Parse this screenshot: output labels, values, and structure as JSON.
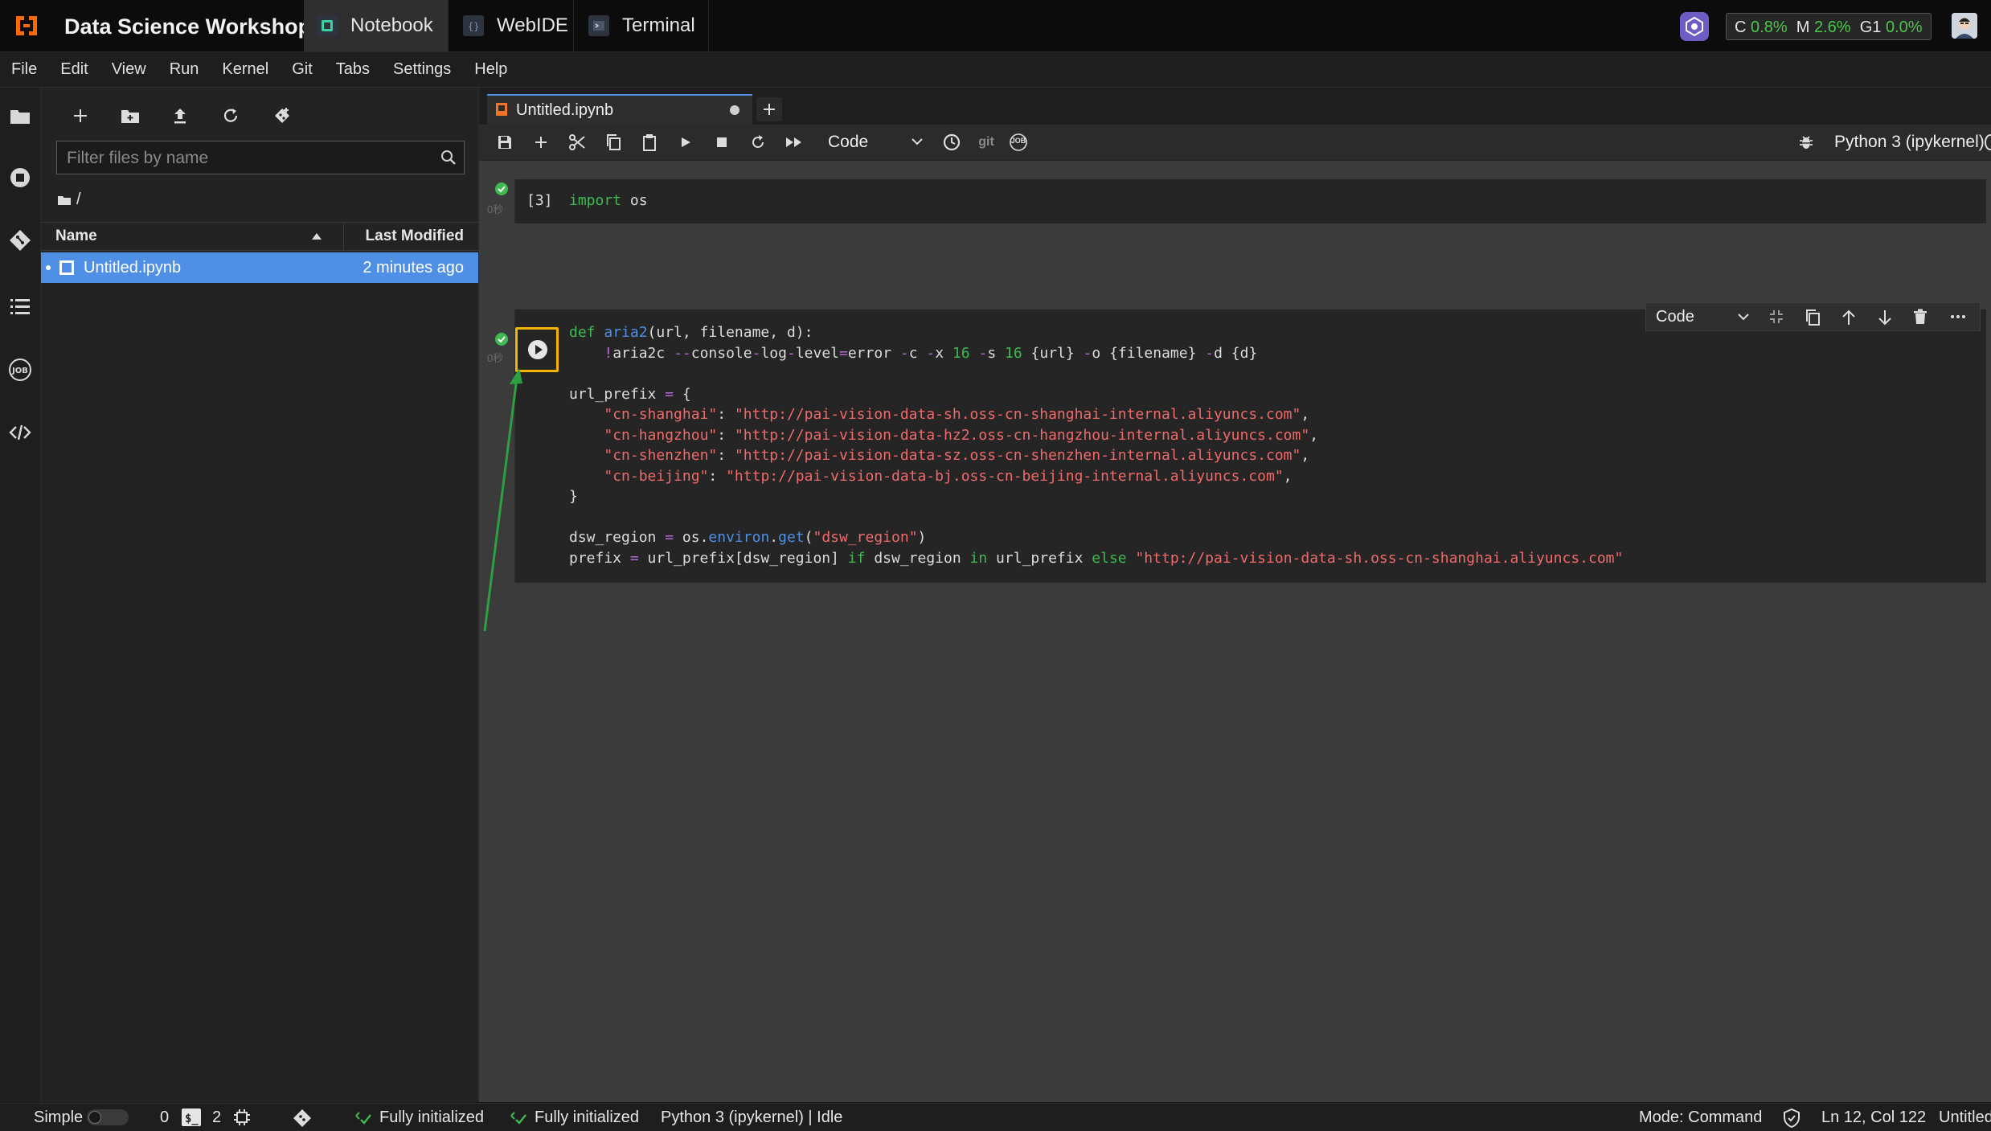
{
  "topbar": {
    "title": "Data Science Workshop",
    "tabs": [
      {
        "label": "Notebook",
        "icon": "notebook-icon"
      },
      {
        "label": "WebIDE",
        "icon": "webide-icon"
      },
      {
        "label": "Terminal",
        "icon": "terminal-icon"
      }
    ],
    "resources": {
      "c_label": "C",
      "c_value": "0.8%",
      "m_label": "M",
      "m_value": "2.6%",
      "g_label": "G1",
      "g_value": "0.0%"
    }
  },
  "menu": [
    "File",
    "Edit",
    "View",
    "Run",
    "Kernel",
    "Git",
    "Tabs",
    "Settings",
    "Help"
  ],
  "filebrowser": {
    "filter_placeholder": "Filter files by name",
    "breadcrumb": "/",
    "columns": {
      "name": "Name",
      "modified": "Last Modified"
    },
    "files": [
      {
        "name": "Untitled.ipynb",
        "modified": "2 minutes ago"
      }
    ]
  },
  "document": {
    "tab_label": "Untitled.ipynb",
    "cell_type": "Code",
    "git_label": "git",
    "job_label": "JOB",
    "kernel": "Python 3 (ipykernel)"
  },
  "cells": [
    {
      "prompt": "[3]",
      "lines": [
        [
          {
            "t": "import",
            "c": "kw"
          },
          {
            "t": " os",
            "c": ""
          }
        ]
      ]
    },
    {
      "prompt": "",
      "lines": [
        [
          {
            "t": "def",
            "c": "kw"
          },
          {
            "t": " ",
            "c": ""
          },
          {
            "t": "aria2",
            "c": "def"
          },
          {
            "t": "(url, filename, d):",
            "c": ""
          }
        ],
        [
          {
            "t": "    ",
            "c": ""
          },
          {
            "t": "!",
            "c": "op"
          },
          {
            "t": "aria2c ",
            "c": ""
          },
          {
            "t": "--",
            "c": "op"
          },
          {
            "t": "console",
            "c": ""
          },
          {
            "t": "-",
            "c": "op"
          },
          {
            "t": "log",
            "c": ""
          },
          {
            "t": "-",
            "c": "op"
          },
          {
            "t": "level",
            "c": ""
          },
          {
            "t": "=",
            "c": "op"
          },
          {
            "t": "error ",
            "c": ""
          },
          {
            "t": "-",
            "c": "op"
          },
          {
            "t": "c ",
            "c": ""
          },
          {
            "t": "-",
            "c": "op"
          },
          {
            "t": "x ",
            "c": ""
          },
          {
            "t": "16",
            "c": "num"
          },
          {
            "t": " ",
            "c": ""
          },
          {
            "t": "-",
            "c": "op"
          },
          {
            "t": "s ",
            "c": ""
          },
          {
            "t": "16",
            "c": "num"
          },
          {
            "t": " {url} ",
            "c": ""
          },
          {
            "t": "-",
            "c": "op"
          },
          {
            "t": "o {filename} ",
            "c": ""
          },
          {
            "t": "-",
            "c": "op"
          },
          {
            "t": "d {d}",
            "c": ""
          }
        ],
        [],
        [
          {
            "t": "url_prefix ",
            "c": ""
          },
          {
            "t": "=",
            "c": "op"
          },
          {
            "t": " {",
            "c": ""
          }
        ],
        [
          {
            "t": "    ",
            "c": ""
          },
          {
            "t": "\"cn-shanghai\"",
            "c": "str"
          },
          {
            "t": ": ",
            "c": ""
          },
          {
            "t": "\"http://pai-vision-data-sh.oss-cn-shanghai-internal.aliyuncs.com\"",
            "c": "str"
          },
          {
            "t": ",",
            "c": ""
          }
        ],
        [
          {
            "t": "    ",
            "c": ""
          },
          {
            "t": "\"cn-hangzhou\"",
            "c": "str"
          },
          {
            "t": ": ",
            "c": ""
          },
          {
            "t": "\"http://pai-vision-data-hz2.oss-cn-hangzhou-internal.aliyuncs.com\"",
            "c": "str"
          },
          {
            "t": ",",
            "c": ""
          }
        ],
        [
          {
            "t": "    ",
            "c": ""
          },
          {
            "t": "\"cn-shenzhen\"",
            "c": "str"
          },
          {
            "t": ": ",
            "c": ""
          },
          {
            "t": "\"http://pai-vision-data-sz.oss-cn-shenzhen-internal.aliyuncs.com\"",
            "c": "str"
          },
          {
            "t": ",",
            "c": ""
          }
        ],
        [
          {
            "t": "    ",
            "c": ""
          },
          {
            "t": "\"cn-beijing\"",
            "c": "str"
          },
          {
            "t": ": ",
            "c": ""
          },
          {
            "t": "\"http://pai-vision-data-bj.oss-cn-beijing-internal.aliyuncs.com\"",
            "c": "str"
          },
          {
            "t": ",",
            "c": ""
          }
        ],
        [
          {
            "t": "}",
            "c": ""
          }
        ],
        [],
        [
          {
            "t": "dsw_region ",
            "c": ""
          },
          {
            "t": "=",
            "c": "op"
          },
          {
            "t": " os.",
            "c": ""
          },
          {
            "t": "environ",
            "c": "def"
          },
          {
            "t": ".",
            "c": ""
          },
          {
            "t": "get",
            "c": "def"
          },
          {
            "t": "(",
            "c": ""
          },
          {
            "t": "\"dsw_region\"",
            "c": "str"
          },
          {
            "t": ")",
            "c": ""
          }
        ],
        [
          {
            "t": "prefix ",
            "c": ""
          },
          {
            "t": "=",
            "c": "op"
          },
          {
            "t": " url_prefix[dsw_region] ",
            "c": ""
          },
          {
            "t": "if",
            "c": "kw"
          },
          {
            "t": " dsw_region ",
            "c": ""
          },
          {
            "t": "in",
            "c": "kw"
          },
          {
            "t": " url_prefix ",
            "c": ""
          },
          {
            "t": "else",
            "c": "kw"
          },
          {
            "t": " ",
            "c": ""
          },
          {
            "t": "\"http://pai-vision-data-sh.oss-cn-shanghai.aliyuncs.com\"",
            "c": "str"
          }
        ]
      ]
    }
  ],
  "cell_toolbar": {
    "cell_type": "Code"
  },
  "statusbar": {
    "mode_simple": "Simple",
    "terminals_count": "0",
    "kernels_count": "2",
    "init1": "Fully initialized",
    "init2": "Fully initialized",
    "kernel_status": "Python 3 (ipykernel) | Idle",
    "mode": "Mode: Command",
    "cursor": "Ln 12, Col 122",
    "file": "Untitled"
  },
  "colors": {
    "accent": "#4f8fe6",
    "success": "#3fb950",
    "highlight": "#f5b400",
    "annotation_arrow": "#2ea043"
  }
}
